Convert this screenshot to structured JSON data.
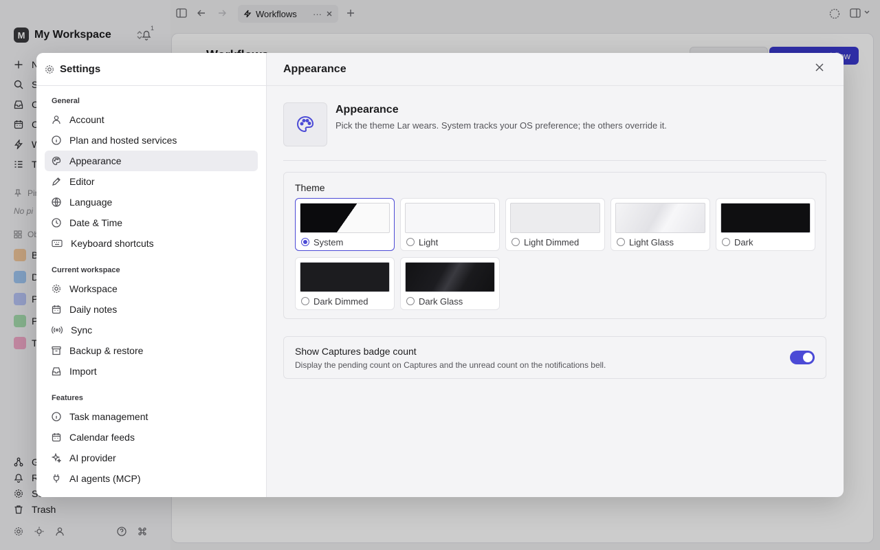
{
  "workspace": {
    "initial": "M",
    "name": "My Workspace",
    "notifications": "1"
  },
  "bg_nav": [
    {
      "label": "New"
    },
    {
      "label": "Search"
    },
    {
      "label": "Captures"
    },
    {
      "label": "Calendar"
    },
    {
      "label": "Workflows"
    },
    {
      "label": "Tasks"
    }
  ],
  "bg_sections": {
    "pinned": "Pinned",
    "pinned_empty": "No pinned items",
    "objects": "Objects"
  },
  "bg_objects": [
    {
      "label": "Books",
      "color": "#f2c79b"
    },
    {
      "label": "Daily",
      "color": "#9fc6f2"
    },
    {
      "label": "People",
      "color": "#b7c3f5"
    },
    {
      "label": "Projects",
      "color": "#a6dcae"
    },
    {
      "label": "Tags",
      "color": "#f2a9c9"
    }
  ],
  "bg_bottom": [
    {
      "label": "Graph"
    },
    {
      "label": "Reminders"
    },
    {
      "label": "Settings"
    },
    {
      "label": "Trash"
    }
  ],
  "topbar": {
    "tab_label": "Workflows",
    "tab_more": "···"
  },
  "main": {
    "title": "Workflows",
    "new_button": "New workflow"
  },
  "settings": {
    "title": "Settings",
    "groups": [
      {
        "title": "General",
        "items": [
          {
            "label": "Account",
            "icon": "user-icon"
          },
          {
            "label": "Plan and hosted services",
            "icon": "info-icon"
          },
          {
            "label": "Appearance",
            "icon": "palette-icon",
            "active": true
          },
          {
            "label": "Editor",
            "icon": "pencil-icon"
          },
          {
            "label": "Language",
            "icon": "globe-icon"
          },
          {
            "label": "Date & Time",
            "icon": "clock-icon"
          },
          {
            "label": "Keyboard shortcuts",
            "icon": "keyboard-icon"
          }
        ]
      },
      {
        "title": "Current workspace",
        "items": [
          {
            "label": "Workspace",
            "icon": "gear-icon"
          },
          {
            "label": "Daily notes",
            "icon": "calendar-icon"
          },
          {
            "label": "Sync",
            "icon": "broadcast-icon"
          },
          {
            "label": "Backup & restore",
            "icon": "archive-icon"
          },
          {
            "label": "Import",
            "icon": "inbox-icon"
          }
        ]
      },
      {
        "title": "Features",
        "items": [
          {
            "label": "Task management",
            "icon": "info-icon"
          },
          {
            "label": "Calendar feeds",
            "icon": "calendar-icon"
          },
          {
            "label": "AI provider",
            "icon": "sparkle-icon"
          },
          {
            "label": "AI agents (MCP)",
            "icon": "plug-icon"
          }
        ]
      }
    ]
  },
  "appearance": {
    "header": "Appearance",
    "hero_title": "Appearance",
    "hero_subtitle": "Pick the theme Lar wears. System tracks your OS preference; the others override it.",
    "theme_label": "Theme",
    "themes": [
      {
        "name": "System",
        "selected": true,
        "preview": "system"
      },
      {
        "name": "Light",
        "selected": false,
        "preview": "#f7f7f9"
      },
      {
        "name": "Light Dimmed",
        "selected": false,
        "preview": "#ececee"
      },
      {
        "name": "Light Glass",
        "selected": false,
        "preview": "glass-light"
      },
      {
        "name": "Dark",
        "selected": false,
        "preview": "#0f0f11"
      },
      {
        "name": "Dark Dimmed",
        "selected": false,
        "preview": "#1c1c1f"
      },
      {
        "name": "Dark Glass",
        "selected": false,
        "preview": "glass-dark"
      }
    ],
    "badge_title": "Show Captures badge count",
    "badge_subtitle": "Display the pending count on Captures and the unread count on the notifications bell.",
    "badge_enabled": true
  },
  "colors": {
    "accent": "#4b4ad6"
  }
}
